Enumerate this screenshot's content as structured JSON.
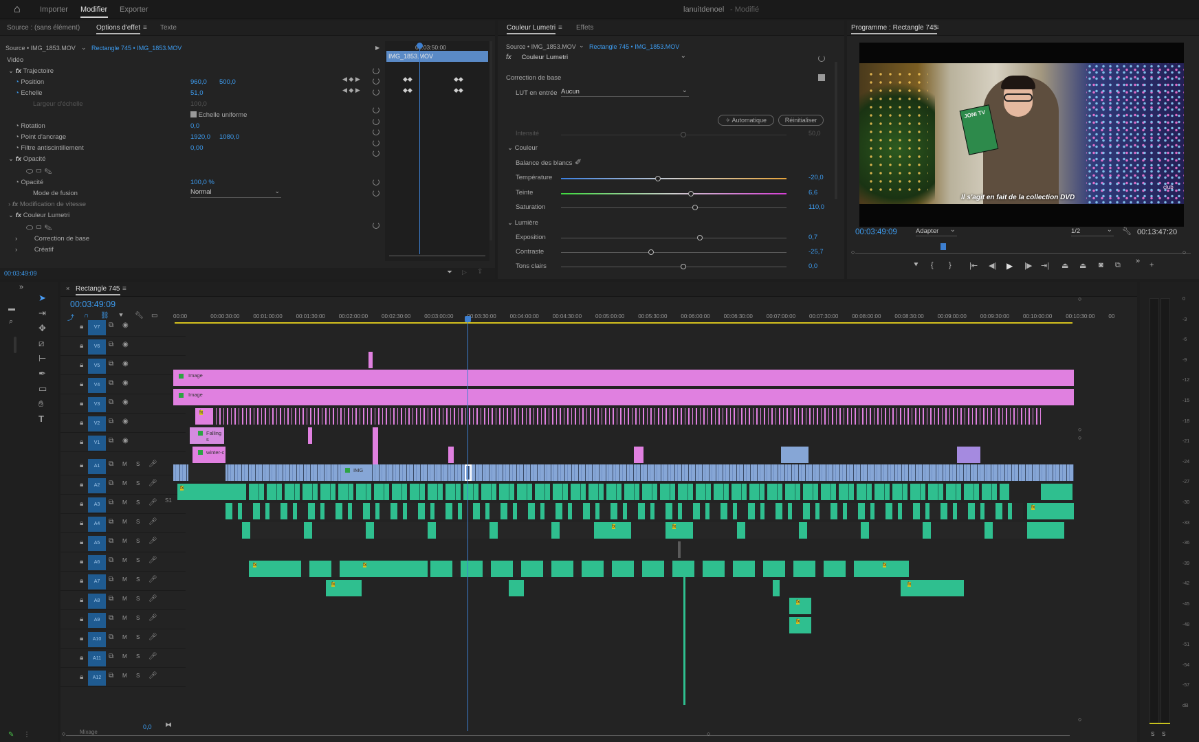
{
  "app": {
    "workspace_tabs": [
      "Importer",
      "Modifier",
      "Exporter"
    ],
    "active_workspace": "Modifier",
    "project_name": "lanuitdenoel",
    "project_status": "- Modifié"
  },
  "effect_panel": {
    "tabs": [
      "Source : (sans élément)",
      "Options d'effet",
      "Texte"
    ],
    "source_label": "Source • IMG_1853.MOV",
    "sequence_label": "Rectangle 745 • IMG_1853.MOV",
    "mini_timecode": "00:03:50:00",
    "mini_clip": "IMG_1853.MOV",
    "section_video": "Vidéo",
    "motion": "Trajectoire",
    "position_label": "Position",
    "position_x": "960,0",
    "position_y": "500,0",
    "scale_label": "Echelle",
    "scale_value": "51,0",
    "scale_width_label": "Largeur d'échelle",
    "scale_width_value": "100,0",
    "uniform_scale": "Echelle uniforme",
    "rotation_label": "Rotation",
    "rotation_value": "0,0",
    "anchor_label": "Point d'ancrage",
    "anchor_x": "1920,0",
    "anchor_y": "1080,0",
    "flicker_label": "Filtre antiscintillement",
    "flicker_value": "0,00",
    "opacity_section": "Opacité",
    "opacity_label": "Opacité",
    "opacity_value": "100,0 %",
    "blend_label": "Mode de fusion",
    "blend_value": "Normal",
    "speed_section": "Modification de vitesse",
    "lumetri_section": "Couleur Lumetri",
    "basic_correction": "Correction de base",
    "creative": "Créatif",
    "footer_timecode": "00:03:49:09"
  },
  "lumetri_panel": {
    "tabs": [
      "Couleur Lumetri",
      "Effets"
    ],
    "source_label": "Source • IMG_1853.MOV",
    "sequence_label": "Rectangle 745 • IMG_1853.MOV",
    "fx_name": "Couleur Lumetri",
    "basic_correction": "Correction de base",
    "lut_label": "LUT en entrée",
    "lut_value": "Aucun",
    "intensity_label": "Intensité",
    "intensity_value": "50,0",
    "auto_button": "Automatique",
    "reset_button": "Réinitialiser",
    "color_section": "Couleur",
    "white_balance": "Balance des blancs",
    "temperature_label": "Température",
    "temperature_value": "-20,0",
    "tint_label": "Teinte",
    "tint_value": "6,6",
    "saturation_label": "Saturation",
    "saturation_value": "110,0",
    "light_section": "Lumière",
    "exposure_label": "Exposition",
    "exposure_value": "0,7",
    "contrast_label": "Contraste",
    "contrast_value": "-25,7",
    "highlights_label": "Tons clairs",
    "highlights_value": "0,0"
  },
  "program_monitor": {
    "title": "Programme : Rectangle 745",
    "subtitle": "Il s'agit en fait de la collection DVD",
    "current_timecode": "00:03:49:09",
    "fit_value": "Adapter",
    "resolution": "1/2",
    "duration": "00:13:47:20",
    "book_label": "JONI TV",
    "sign_label": "club"
  },
  "timeline": {
    "sequence_name": "Rectangle 745",
    "timecode": "00:03:49:09",
    "ruler": [
      "00:00",
      "00:00:30:00",
      "00:01:00:00",
      "00:01:30:00",
      "00:02:00:00",
      "00:02:30:00",
      "00:03:00:00",
      "00:03:30:00",
      "00:04:00:00",
      "00:04:30:00",
      "00:05:00:00",
      "00:05:30:00",
      "00:06:00:00",
      "00:06:30:00",
      "00:07:00:00",
      "00:07:30:00",
      "00:08:00:00",
      "00:08:30:00",
      "00:09:00:00",
      "00:09:30:00",
      "00:10:00:00",
      "00:10:30:00",
      "00"
    ],
    "video_tracks": [
      "V7",
      "V6",
      "V5",
      "V4",
      "V3",
      "V2",
      "V1"
    ],
    "audio_tracks": [
      "A1",
      "A2",
      "A3",
      "A4",
      "A5",
      "A6",
      "A7",
      "A8",
      "A9",
      "A10",
      "A11",
      "A12"
    ],
    "clip_labels": {
      "image1": "Image",
      "image2": "Image",
      "falling": "Falling s",
      "winter": "winter-c",
      "img": "IMG"
    },
    "mix_label": "Mixage",
    "mix_value": "0,0",
    "s1_label": "S1"
  },
  "meter": {
    "ticks": [
      "0",
      "-3",
      "-6",
      "-9",
      "-12",
      "-15",
      "-18",
      "-21",
      "-24",
      "-27",
      "-30",
      "-33",
      "-36",
      "-39",
      "-42",
      "-45",
      "-48",
      "-51",
      "-54",
      "-57",
      "dB"
    ],
    "solo_labels": [
      "S",
      "S"
    ]
  },
  "colors": {
    "accent": "#3d9cf0",
    "video_clip_pink": "#e080e0",
    "video_clip_blue": "#86a6d6",
    "audio_clip_green": "#2fbf8f",
    "playhead": "#3d7fd0"
  }
}
